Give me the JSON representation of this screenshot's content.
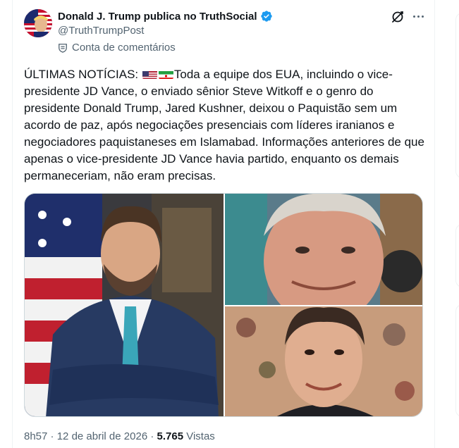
{
  "post": {
    "author_name": "Donald J. Trump publica no TruthSocial",
    "handle": "@TruthTrumpPost",
    "community_label": "Conta de comentários",
    "text_prefix": "ÚLTIMAS NOTÍCIAS:",
    "text_body": "Toda a equipe dos EUA, incluindo o vice-presidente JD Vance, o enviado sênior Steve Witkoff e o genro do presidente Donald Trump, Jared Kushner, deixou o Paquistão sem um acordo de paz, após negociações presenciais com líderes iranianos e negociadores paquistaneses em Islamabad. Informações anteriores de que apenas o vice-presidente JD Vance havia partido, enquanto os demais permaneceriam, não eram precisas.",
    "flags": [
      "us-flag-icon",
      "iran-flag-icon"
    ],
    "time": "8h57",
    "separator": "·",
    "date": "12 de abril de 2026",
    "views_count": "5.765",
    "views_label": "Vistas"
  },
  "icons": {
    "verified": "verified-badge-icon",
    "grok": "grok-icon",
    "more": "more-icon",
    "community": "community-shield-icon"
  },
  "colors": {
    "verified_blue": "#1d9bf0",
    "text_primary": "#0f1419",
    "text_secondary": "#536471",
    "border": "#cfd9de"
  }
}
